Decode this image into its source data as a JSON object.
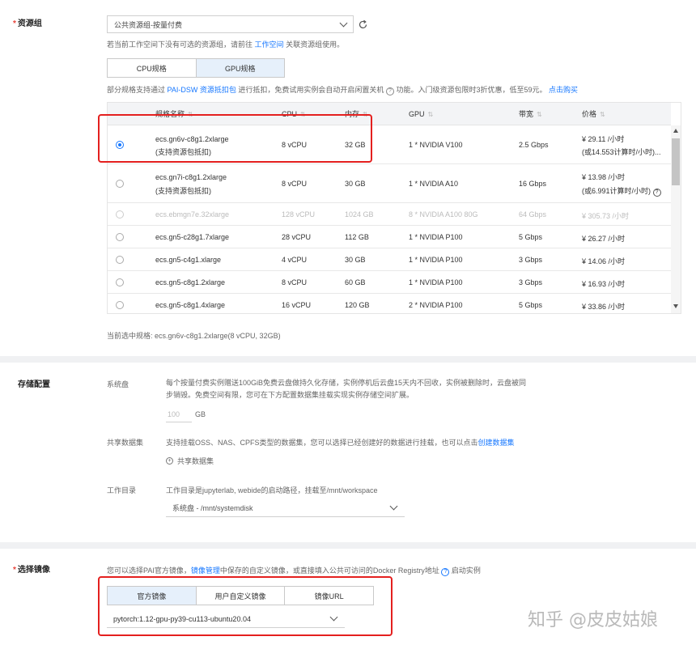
{
  "resource_group": {
    "label": "资源组",
    "select_value": "公共资源组-按量付费",
    "hint_prefix": "若当前工作空间下没有可选的资源组，请前往",
    "hint_link": "工作空间",
    "hint_suffix": "关联资源组使用。",
    "spec_tabs": [
      "CPU规格",
      "GPU规格"
    ],
    "notice_prefix": "部分规格支持通过",
    "notice_link": "PAI-DSW 资源抵扣包",
    "notice_mid": "进行抵扣，免费试用实例会自动开启闲置关机",
    "notice_suffix": "功能。入门级资源包限时3折优惠，低至59元。",
    "notice_buy": "点击购买",
    "columns": [
      "规格名称",
      "CPU",
      "内存",
      "GPU",
      "带宽",
      "价格"
    ],
    "rows": [
      {
        "name": "ecs.gn6v-c8g1.2xlarge",
        "name2": "(支持资源包抵扣)",
        "cpu": "8 vCPU",
        "mem": "32 GB",
        "gpu": "1 * NVIDIA V100",
        "bw": "2.5 Gbps",
        "price": "¥ 29.11 /小时",
        "price2": "(或14.553计算时/小时)..."
      },
      {
        "name": "ecs.gn7i-c8g1.2xlarge",
        "name2": "(支持资源包抵扣)",
        "cpu": "8 vCPU",
        "mem": "30 GB",
        "gpu": "1 * NVIDIA A10",
        "bw": "16 Gbps",
        "price": "¥ 13.98 /小时",
        "price2": "(或6.991计算时/小时)"
      },
      {
        "name": "ecs.ebmgn7e.32xlarge",
        "cpu": "128 vCPU",
        "mem": "1024 GB",
        "gpu": "8 * NVIDIA A100 80G",
        "bw": "64 Gbps",
        "price": "¥ 305.73 /小时"
      },
      {
        "name": "ecs.gn5-c28g1.7xlarge",
        "cpu": "28 vCPU",
        "mem": "112 GB",
        "gpu": "1 * NVIDIA P100",
        "bw": "5 Gbps",
        "price": "¥ 26.27 /小时"
      },
      {
        "name": "ecs.gn5-c4g1.xlarge",
        "cpu": "4 vCPU",
        "mem": "30 GB",
        "gpu": "1 * NVIDIA P100",
        "bw": "3 Gbps",
        "price": "¥ 14.06 /小时"
      },
      {
        "name": "ecs.gn5-c8g1.2xlarge",
        "cpu": "8 vCPU",
        "mem": "60 GB",
        "gpu": "1 * NVIDIA P100",
        "bw": "3 Gbps",
        "price": "¥ 16.93 /小时"
      },
      {
        "name": "ecs.gn5-c8g1.4xlarge",
        "cpu": "16 vCPU",
        "mem": "120 GB",
        "gpu": "2 * NVIDIA P100",
        "bw": "5 Gbps",
        "price": "¥ 33.86 /小时"
      }
    ],
    "current": "当前选中规格: ecs.gn6v-c8g1.2xlarge(8 vCPU, 32GB)"
  },
  "storage": {
    "label": "存储配置",
    "system_disk_label": "系统盘",
    "system_disk_desc1": "每个按量付费实例赠送100GiB免费云盘做持久化存储，实例停机后云盘15天内不回收，实例被删除时，云盘被同",
    "system_disk_desc2": "步销毁。免费空间有限，您可在下方配置数据集挂载实现实例存储空间扩展。",
    "disk_size_placeholder": "100",
    "disk_unit": "GB",
    "dataset_label": "共享数据集",
    "dataset_desc": "支持挂载OSS、NAS、CPFS类型的数据集，您可以选择已经创建好的数据进行挂载，也可以点击",
    "dataset_link": "创建数据集",
    "shared_dataset_add": "共享数据集",
    "workdir_label": "工作目录",
    "workdir_desc": "工作目录是jupyterlab, webide的启动路径，挂载至/mnt/workspace",
    "workdir_value": "系统盘 - /mnt/systemdisk"
  },
  "image": {
    "label": "选择镜像",
    "desc_prefix": "您可以选择PAI官方镜像，",
    "desc_link": "镜像管理",
    "desc_suffix": "中保存的自定义镜像，或直接填入公共可访问的Docker Registry地址",
    "desc_end": "启动实例",
    "tabs": [
      "官方镜像",
      "用户自定义镜像",
      "镜像URL"
    ],
    "value": "pytorch:1.12-gpu-py39-cu113-ubuntu20.04"
  },
  "watermark": "知乎 @皮皮姑娘",
  "colors": {
    "accent": "#1677ff",
    "highlight": "#e4201f",
    "tab_active": "#e6f0fb"
  }
}
